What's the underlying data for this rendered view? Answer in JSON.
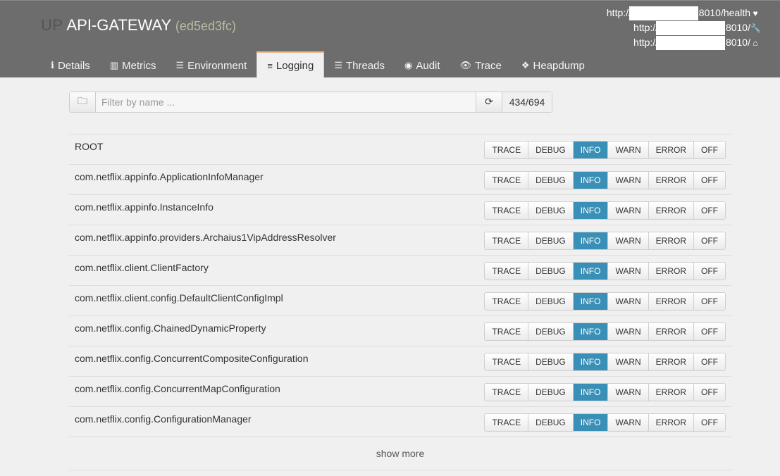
{
  "app": {
    "prefix": "UP",
    "name": "API-GATEWAY",
    "instance_id": "(ed5ed3fc)"
  },
  "urls": [
    {
      "scheme": "http://",
      "suffix": ":8010/health",
      "icon": "heartbeat-icon",
      "glyph": "♥"
    },
    {
      "scheme": "http://",
      "suffix": ":8010/",
      "icon": "wrench-icon",
      "glyph": "🔧"
    },
    {
      "scheme": "http://",
      "suffix": ":8010/",
      "icon": "home-icon",
      "glyph": "⌂"
    }
  ],
  "tabs": [
    {
      "label": "Details",
      "icon": "info-icon",
      "glyph": "ℹ"
    },
    {
      "label": "Metrics",
      "icon": "bar-chart-icon",
      "glyph": "▥"
    },
    {
      "label": "Environment",
      "icon": "list-icon",
      "glyph": "☰"
    },
    {
      "label": "Logging",
      "icon": "sliders-icon",
      "glyph": "≡",
      "active": true
    },
    {
      "label": "Threads",
      "icon": "threads-icon",
      "glyph": "☰"
    },
    {
      "label": "Audit",
      "icon": "user-icon",
      "glyph": "◉"
    },
    {
      "label": "Trace",
      "icon": "eye-icon",
      "glyph": "👁"
    },
    {
      "label": "Heapdump",
      "icon": "cubes-icon",
      "glyph": "❖"
    }
  ],
  "filter": {
    "folder_icon": "folder-icon",
    "placeholder": "Filter by name ...",
    "value": "",
    "refresh_icon": "refresh-icon",
    "count": "434/694"
  },
  "levels": [
    "TRACE",
    "DEBUG",
    "INFO",
    "WARN",
    "ERROR",
    "OFF"
  ],
  "loggers": [
    {
      "name": "ROOT",
      "level": "INFO"
    },
    {
      "name": "com.netflix.appinfo.ApplicationInfoManager",
      "level": "INFO"
    },
    {
      "name": "com.netflix.appinfo.InstanceInfo",
      "level": "INFO"
    },
    {
      "name": "com.netflix.appinfo.providers.Archaius1VipAddressResolver",
      "level": "INFO"
    },
    {
      "name": "com.netflix.client.ClientFactory",
      "level": "INFO"
    },
    {
      "name": "com.netflix.client.config.DefaultClientConfigImpl",
      "level": "INFO"
    },
    {
      "name": "com.netflix.config.ChainedDynamicProperty",
      "level": "INFO"
    },
    {
      "name": "com.netflix.config.ConcurrentCompositeConfiguration",
      "level": "INFO"
    },
    {
      "name": "com.netflix.config.ConcurrentMapConfiguration",
      "level": "INFO"
    },
    {
      "name": "com.netflix.config.ConfigurationManager",
      "level": "INFO"
    }
  ],
  "show_more": "show more",
  "colors": {
    "header_bg": "#6d6d6d",
    "active_level": "#3a8fb7",
    "active_tab_border": "#e8b98a"
  }
}
